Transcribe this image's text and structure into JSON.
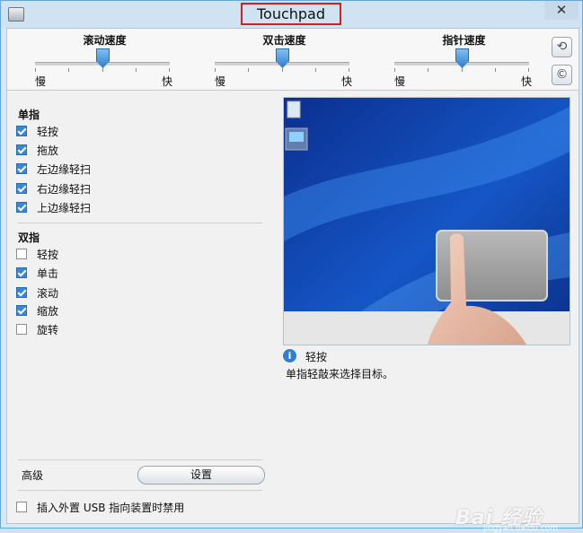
{
  "window": {
    "title": "Touchpad",
    "close_glyph": "✕",
    "icon": "touchpad-app-icon"
  },
  "speed_sliders": [
    {
      "label": "滚动速度",
      "min_label": "慢",
      "max_label": "快",
      "level": 0.5
    },
    {
      "label": "双击速度",
      "min_label": "慢",
      "max_label": "快",
      "level": 0.5
    },
    {
      "label": "指针速度",
      "min_label": "慢",
      "max_label": "快",
      "level": 0.5
    }
  ],
  "side_buttons": {
    "reset_glyph": "⟲",
    "copyright_glyph": "©"
  },
  "single_finger": {
    "title": "单指",
    "items": [
      {
        "label": "轻按",
        "checked": true
      },
      {
        "label": "拖放",
        "checked": true
      },
      {
        "label": "左边缘轻扫",
        "checked": true
      },
      {
        "label": "右边缘轻扫",
        "checked": true
      },
      {
        "label": "上边缘轻扫",
        "checked": true
      }
    ]
  },
  "two_finger": {
    "title": "双指",
    "items": [
      {
        "label": "轻按",
        "checked": false
      },
      {
        "label": "单击",
        "checked": true
      },
      {
        "label": "滚动",
        "checked": true
      },
      {
        "label": "缩放",
        "checked": true
      },
      {
        "label": "旋转",
        "checked": false
      }
    ]
  },
  "advanced": {
    "label": "高级",
    "settings_button": "设置"
  },
  "disable_usb": {
    "label": "插入外置 USB 指向装置时禁用",
    "checked": false
  },
  "tip": {
    "icon": "info-icon",
    "info_glyph": "i",
    "title": "轻按",
    "description": "单指轻敲来选择目标。"
  },
  "watermark": {
    "brand": "Bai 经验",
    "url": "jingyan.baidu.com"
  },
  "colors": {
    "accent": "#2f7fcd",
    "title_box": "#d31f1f",
    "window_frame": "#d7e8f6"
  }
}
